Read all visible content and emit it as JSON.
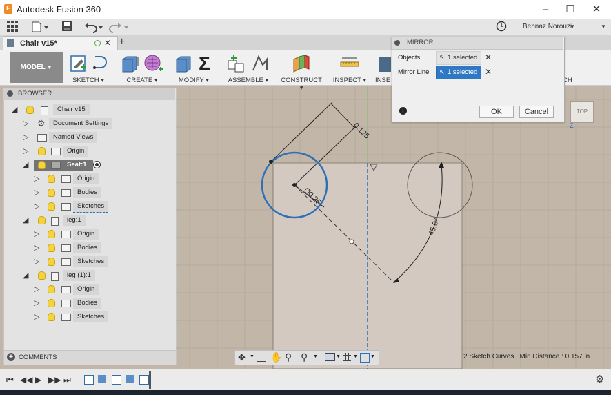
{
  "window": {
    "title": "Autodesk Fusion 360",
    "app_icon": "fusion-f-icon",
    "controls": [
      "minimize-icon",
      "maximize-icon",
      "close-icon"
    ]
  },
  "toolbar": {
    "user_name": "Behnaz Norouzi",
    "help_label": "?"
  },
  "tab": {
    "label": "Chair v15*"
  },
  "ribbon": {
    "model_label": "MODEL",
    "groups": [
      "SKETCH",
      "CREATE",
      "MODIFY",
      "ASSEMBLE",
      "CONSTRUCT",
      "INSPECT",
      "INSERT",
      "SKETCH"
    ],
    "insert_partial": "INSE",
    "sketch_partial": "CH"
  },
  "browser": {
    "title": "BROWSER",
    "comments": "COMMENTS",
    "root": "Chair v15",
    "items": [
      {
        "label": "Document Settings"
      },
      {
        "label": "Named Views"
      },
      {
        "label": "Origin"
      },
      {
        "label": "Seat:1"
      },
      {
        "label": "Origin"
      },
      {
        "label": "Bodies"
      },
      {
        "label": "Sketches"
      },
      {
        "label": "leg:1"
      },
      {
        "label": "Origin"
      },
      {
        "label": "Bodies"
      },
      {
        "label": "Sketches"
      },
      {
        "label": "leg (1):1"
      },
      {
        "label": "Origin"
      },
      {
        "label": "Bodies"
      },
      {
        "label": "Sketches"
      }
    ]
  },
  "mirror_dialog": {
    "title": "MIRROR",
    "objects_label": "Objects",
    "objects_value": "1 selected",
    "mirror_line_label": "Mirror Line",
    "mirror_line_value": "1 selected",
    "ok": "OK",
    "cancel": "Cancel"
  },
  "viewcube": {
    "label": "TOP",
    "axis": "Z"
  },
  "canvas": {
    "dim_length": "0.125",
    "dim_diameter": "Ø0.25",
    "dim_angle": "45.0°"
  },
  "status": {
    "text": "2 Sketch Curves | Min Distance : 0.157 in"
  },
  "colors": {
    "canvas_bg": "#c2b6a8",
    "selection_blue": "#2d6fb8",
    "accent_red": "#d43c2c"
  }
}
